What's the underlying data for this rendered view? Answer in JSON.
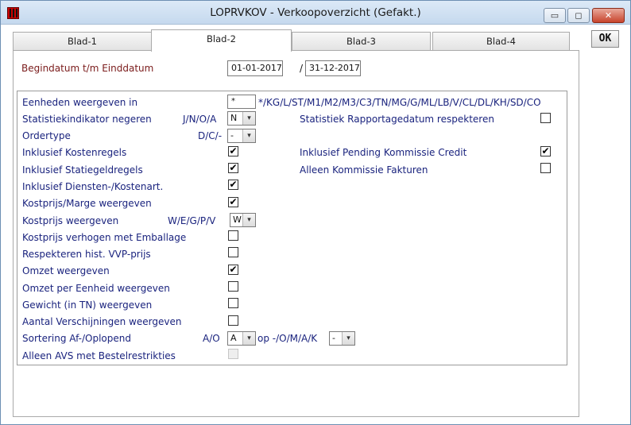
{
  "window": {
    "title": "LOPRVKOV - Verkoopoverzicht (Gefakt.)",
    "controls": {
      "minimize": "▭",
      "maximize": "◻",
      "close": "✕"
    }
  },
  "tabs": [
    {
      "label": "Blad-1",
      "active": false
    },
    {
      "label": "Blad-2",
      "active": true
    },
    {
      "label": "Blad-3",
      "active": false
    },
    {
      "label": "Blad-4",
      "active": false
    }
  ],
  "ok_button": {
    "label": "OK"
  },
  "dates": {
    "label": "Begindatum t/m Einddatum",
    "begin": "01-01-2017",
    "separator": "/",
    "end": "31-12-2017"
  },
  "options": {
    "eenheden": {
      "label": "Eenheden weergeven in",
      "value": "*",
      "hint": "*/KG/L/ST/M1/M2/M3/C3/TN/MG/G/ML/LB/V/CL/DL/KH/SD/CO"
    },
    "stat_negeren": {
      "label": "Statistiekindikator negeren",
      "code": "J/N/O/A",
      "value": "N"
    },
    "ordertype": {
      "label": "Ordertype",
      "code": "D/C/-",
      "value": "-"
    },
    "kostenregels": {
      "label": "Inklusief Kostenregels",
      "checked": true
    },
    "statiegeld": {
      "label": "Inklusief Statiegeldregels",
      "checked": true
    },
    "diensten": {
      "label": "Inklusief Diensten-/Kostenart.",
      "checked": true
    },
    "kostprijs_marge": {
      "label": "Kostprijs/Marge weergeven",
      "checked": true
    },
    "kostprijs_weergeven": {
      "label": "Kostprijs weergeven",
      "code": "W/E/G/P/V",
      "value": "W"
    },
    "kostprijs_emballage": {
      "label": "Kostprijs verhogen met Emballage",
      "checked": false
    },
    "vvp": {
      "label": "Respekteren hist. VVP-prijs",
      "checked": false
    },
    "omzet": {
      "label": "Omzet weergeven",
      "checked": true
    },
    "omzet_eenheid": {
      "label": "Omzet per Eenheid weergeven",
      "checked": false
    },
    "gewicht": {
      "label": "Gewicht (in TN) weergeven",
      "checked": false
    },
    "verschijningen": {
      "label": "Aantal Verschijningen weergeven",
      "checked": false
    },
    "sortering": {
      "label": "Sortering Af-/Oplopend",
      "code": "A/O",
      "value": "A",
      "op_label": "op -/O/M/A/K",
      "op_value": "-"
    },
    "avs": {
      "label": "Alleen AVS met Bestelrestrikties",
      "checked": false,
      "disabled": true
    },
    "rapportagedatum": {
      "label": "Statistiek Rapportagedatum respekteren",
      "checked": false
    },
    "pending_credit": {
      "label": "Inklusief Pending Kommissie Credit",
      "checked": true
    },
    "kommissie_fakturen": {
      "label": "Alleen Kommissie Fakturen",
      "checked": false
    }
  },
  "glyphs": {
    "check": "✔",
    "dropdown": "▾"
  },
  "colors": {
    "label_blue": "#1a237e",
    "date_label_red": "#7a1b1b",
    "app_icon_red": "#cc0000"
  }
}
